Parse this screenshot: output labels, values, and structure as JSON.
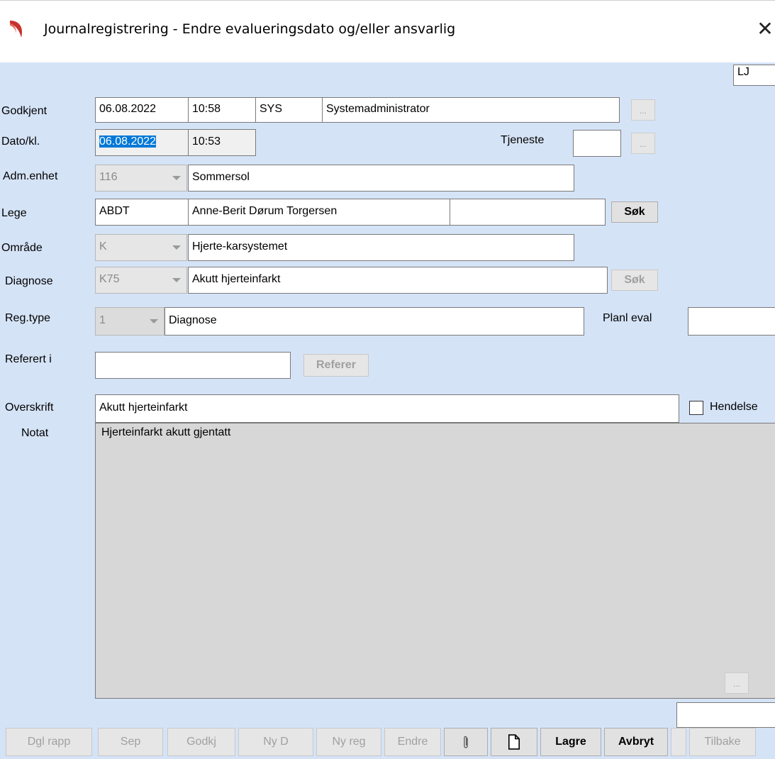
{
  "window": {
    "title": "Journalregistrering - Endre evalueringsdato og/eller ansvarlig",
    "close_glyph": "✕",
    "logo_icon": "app-logo-red-arc"
  },
  "header": {
    "user_code": "LJ"
  },
  "godkjent": {
    "label": "Godkjent",
    "date": "06.08.2022",
    "time": "10:58",
    "user_code": "SYS",
    "user_name": "Systemadministrator",
    "lookup": "..."
  },
  "dato": {
    "label": "Dato/kl.",
    "date": "06.08.2022",
    "time": "10:53",
    "tjeneste_label": "Tjeneste",
    "tjeneste_value": "",
    "lookup": "..."
  },
  "adm_enhet": {
    "label": "Adm.enhet",
    "code": "116",
    "name": "Sommersol"
  },
  "lege": {
    "label": "Lege",
    "code": "ABDT",
    "name": "Anne-Berit Dørum Torgersen",
    "extra": "",
    "search_label": "Søk"
  },
  "omrade": {
    "label": "Område",
    "code": "K",
    "name": "Hjerte-karsystemet"
  },
  "diagnose": {
    "label": "Diagnose",
    "code": "K75",
    "name": "Akutt hjerteinfarkt",
    "search_label": "Søk"
  },
  "reg_type": {
    "label": "Reg.type",
    "code": "1",
    "name": "Diagnose",
    "planl_eval_label": "Planl eval",
    "planl_eval_value": ""
  },
  "referert": {
    "label": "Referert i",
    "value": "",
    "button_label": "Referer"
  },
  "overskrift": {
    "label": "Overskrift",
    "value": "Akutt hjerteinfarkt",
    "hendelse_label": "Hendelse",
    "hendelse_checked": false
  },
  "notat": {
    "label": "Notat",
    "text": "Hjerteinfarkt akutt gjentatt",
    "lookup": "..."
  },
  "bottom_field": "",
  "toolbar": {
    "dgl_rapp": "Dgl rapp",
    "sep": "Sep",
    "godkj": "Godkj",
    "ny_d": "Ny D",
    "ny_reg": "Ny reg",
    "endre": "Endre",
    "lagre": "Lagre",
    "avbryt": "Avbryt",
    "tilbake": "Tilbake"
  },
  "colors": {
    "client_bg": "#d5e3f7",
    "selection": "#0078d7",
    "logo": "#c8312c"
  }
}
